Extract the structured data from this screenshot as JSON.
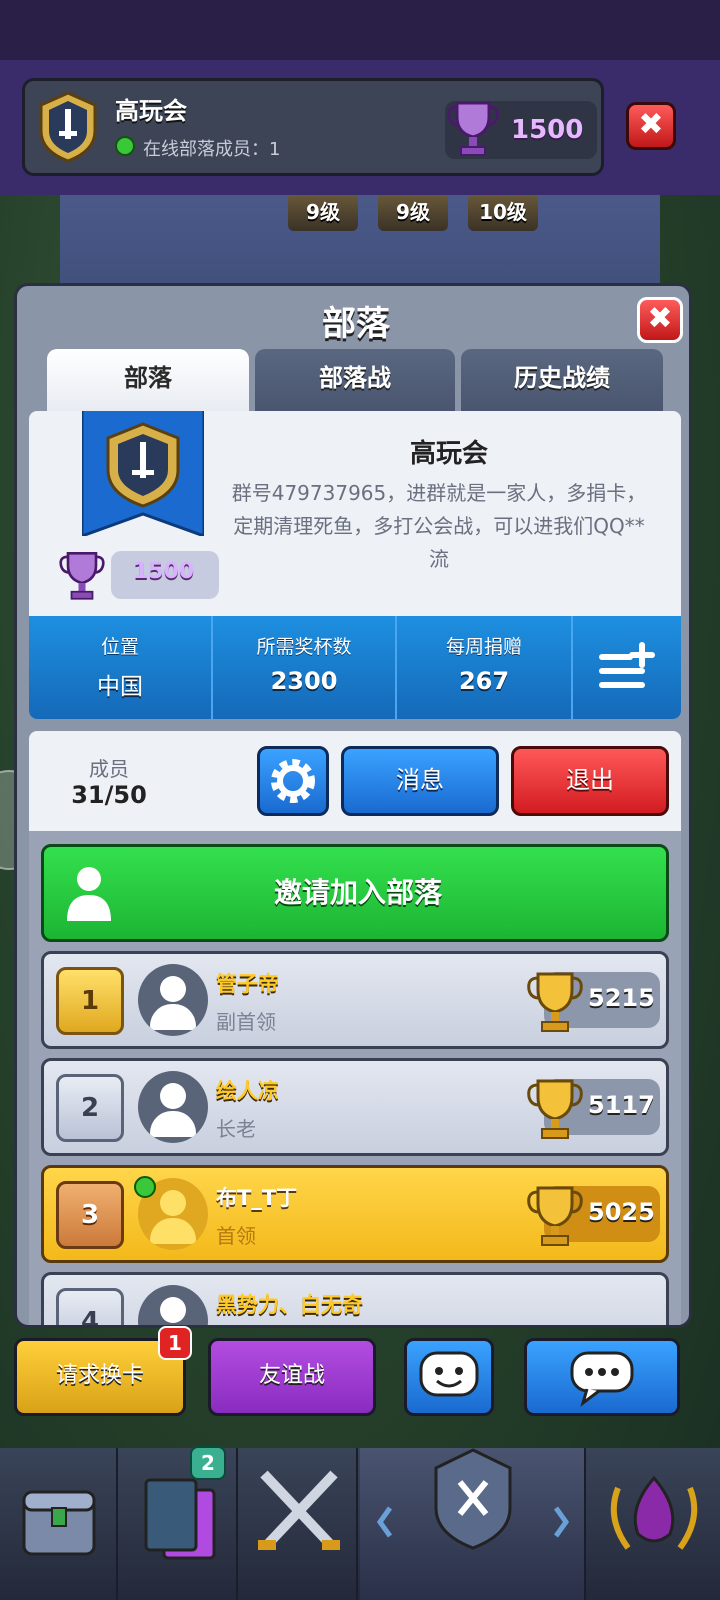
{
  "top_header": {
    "clan_name": "高玩会",
    "online_label": "在线部落成员：1",
    "trophies": "1500",
    "close_label": "✖"
  },
  "background": {
    "levels": [
      "9级",
      "9级",
      "10级"
    ]
  },
  "panel": {
    "title": "部落",
    "close_label": "✖",
    "tabs": [
      {
        "label": "部落",
        "active": true
      },
      {
        "label": "部落战",
        "active": false
      },
      {
        "label": "历史战绩",
        "active": false
      }
    ]
  },
  "clan_info": {
    "name": "高玩会",
    "description": "群号479737965，进群就是一家人，多捐卡，定期清理死鱼，多打公会战，可以进我们QQ**流",
    "trophies": "1500",
    "stats": [
      {
        "label": "位置",
        "value": "中国"
      },
      {
        "label": "所需奖杯数",
        "value": "2300"
      },
      {
        "label": "每周捐赠",
        "value": "267"
      }
    ]
  },
  "members": {
    "label": "成员",
    "count": "31/50",
    "message_button": "消息",
    "quit_button": "退出",
    "invite_button": "邀请加入部落"
  },
  "member_list": [
    {
      "rank": "1",
      "name": "管子帝",
      "role": "副首领",
      "trophies": "5215",
      "me": false,
      "online": false
    },
    {
      "rank": "2",
      "name": "绘人凉",
      "role": "长老",
      "trophies": "5117",
      "me": false,
      "online": false
    },
    {
      "rank": "3",
      "name": "布T_T丁",
      "role": "首领",
      "trophies": "5025",
      "me": true,
      "online": true
    },
    {
      "rank": "4",
      "name": "黑势力、白无奇",
      "role": "",
      "trophies": "",
      "me": false,
      "online": false
    }
  ],
  "bottom_actions": {
    "request_label": "请求换卡",
    "request_badge": "1",
    "friendly_label": "友谊战"
  },
  "nav": {
    "cards_badge": "2"
  },
  "colors": {
    "panel_bg": "#8a95a8",
    "stats_blue": "#1e8fe0",
    "invite_green": "#1cb533",
    "quit_red": "#d21c22",
    "highlight_gold": "#f3b91a"
  }
}
